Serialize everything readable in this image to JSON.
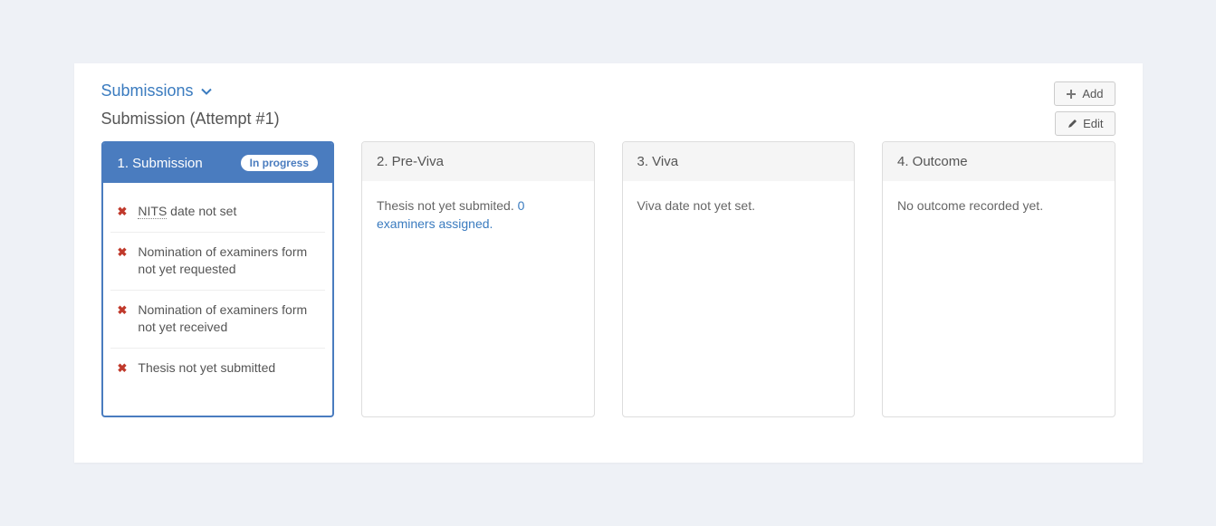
{
  "section": {
    "title": "Submissions",
    "subtitle": "Submission (Attempt #1)"
  },
  "buttons": {
    "add": "Add",
    "edit": "Edit"
  },
  "cards": {
    "submission": {
      "title": "1. Submission",
      "badge": "In progress",
      "items": [
        {
          "prefix": "NITS",
          "suffix": " date not set"
        },
        {
          "text": "Nomination of examiners form not yet requested"
        },
        {
          "text": "Nomination of examiners form not yet received"
        },
        {
          "text": "Thesis not yet submitted"
        }
      ]
    },
    "previva": {
      "title": "2. Pre-Viva",
      "body_prefix": "Thesis not yet submited. ",
      "link": "0 examiners assigned."
    },
    "viva": {
      "title": "3. Viva",
      "body": "Viva date not yet set."
    },
    "outcome": {
      "title": "4. Outcome",
      "body": "No outcome recorded yet."
    }
  }
}
